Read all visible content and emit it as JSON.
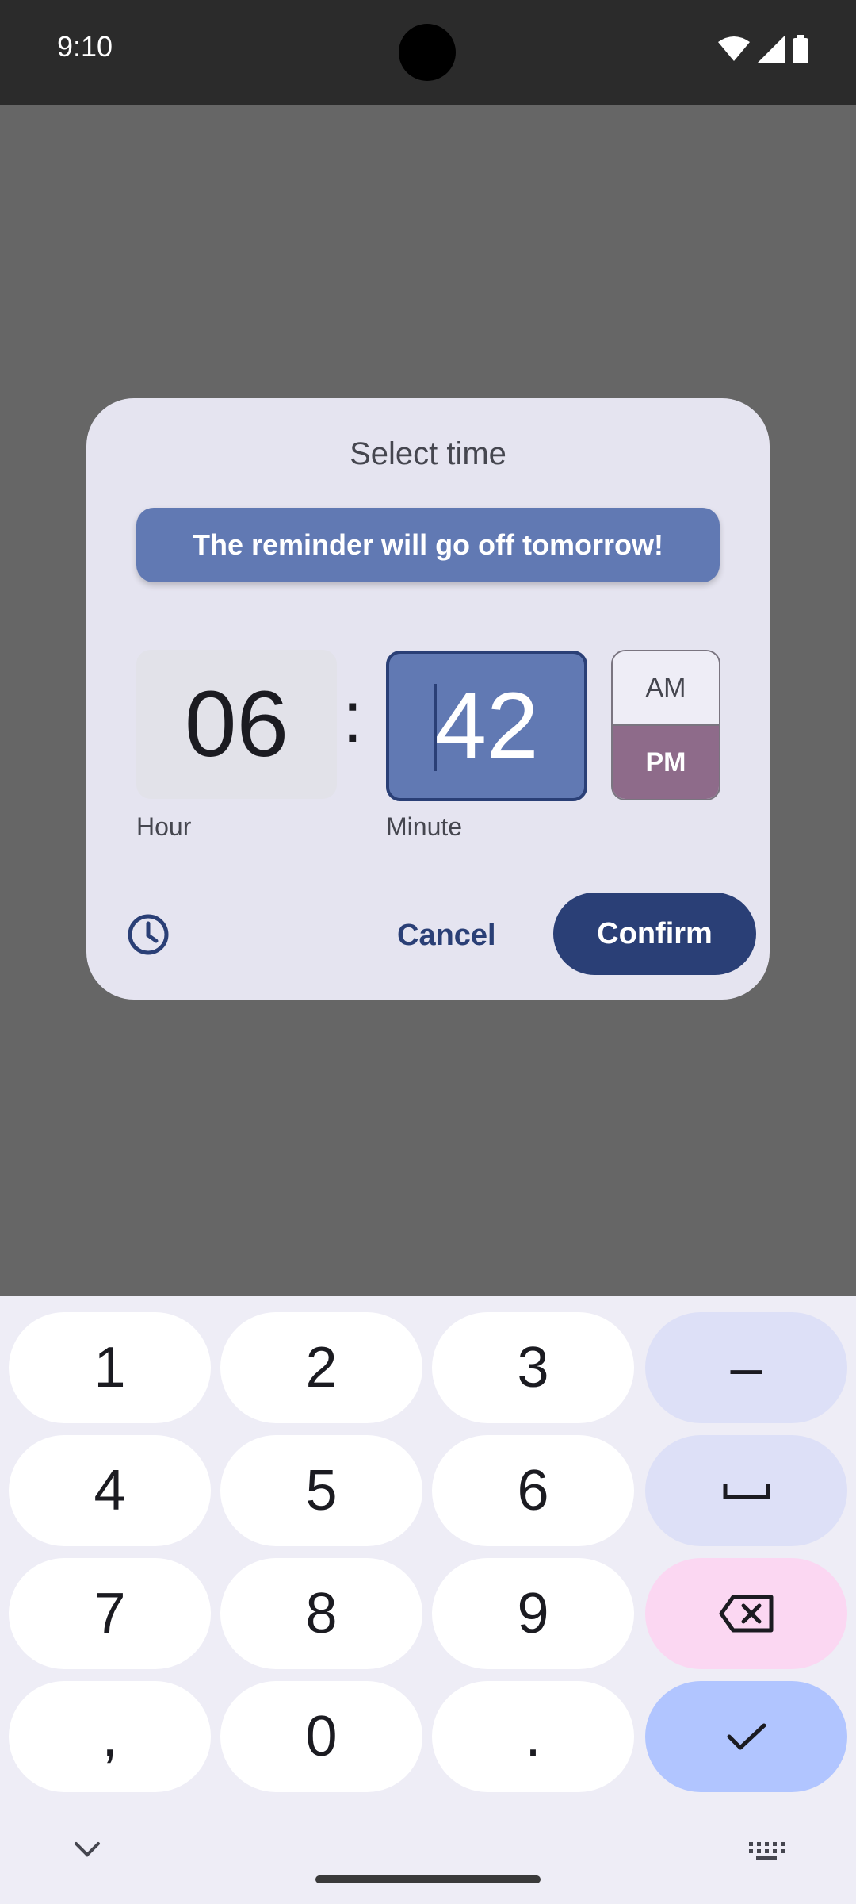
{
  "status_bar": {
    "time": "9:10",
    "icons": [
      "wifi-icon",
      "signal-icon",
      "battery-icon"
    ]
  },
  "dialog": {
    "title": "Select time",
    "banner": "The reminder will go off tomorrow!",
    "hour": "06",
    "separator": ":",
    "minute": "42",
    "am_label": "AM",
    "pm_label": "PM",
    "selected_period": "PM",
    "hour_label": "Hour",
    "minute_label": "Minute",
    "cancel_label": "Cancel",
    "confirm_label": "Confirm"
  },
  "keyboard": {
    "keys": {
      "k1": "1",
      "k2": "2",
      "k3": "3",
      "dash": "–",
      "k4": "4",
      "k5": "5",
      "k6": "6",
      "k7": "7",
      "k8": "8",
      "k9": "9",
      "comma": ",",
      "k0": "0",
      "period": "."
    }
  },
  "colors": {
    "accent": "#2a3f76",
    "banner": "#6179b3",
    "pm_selected": "#8e6b8a",
    "dialog_bg": "#e5e4f0",
    "scrim": "#666666"
  }
}
